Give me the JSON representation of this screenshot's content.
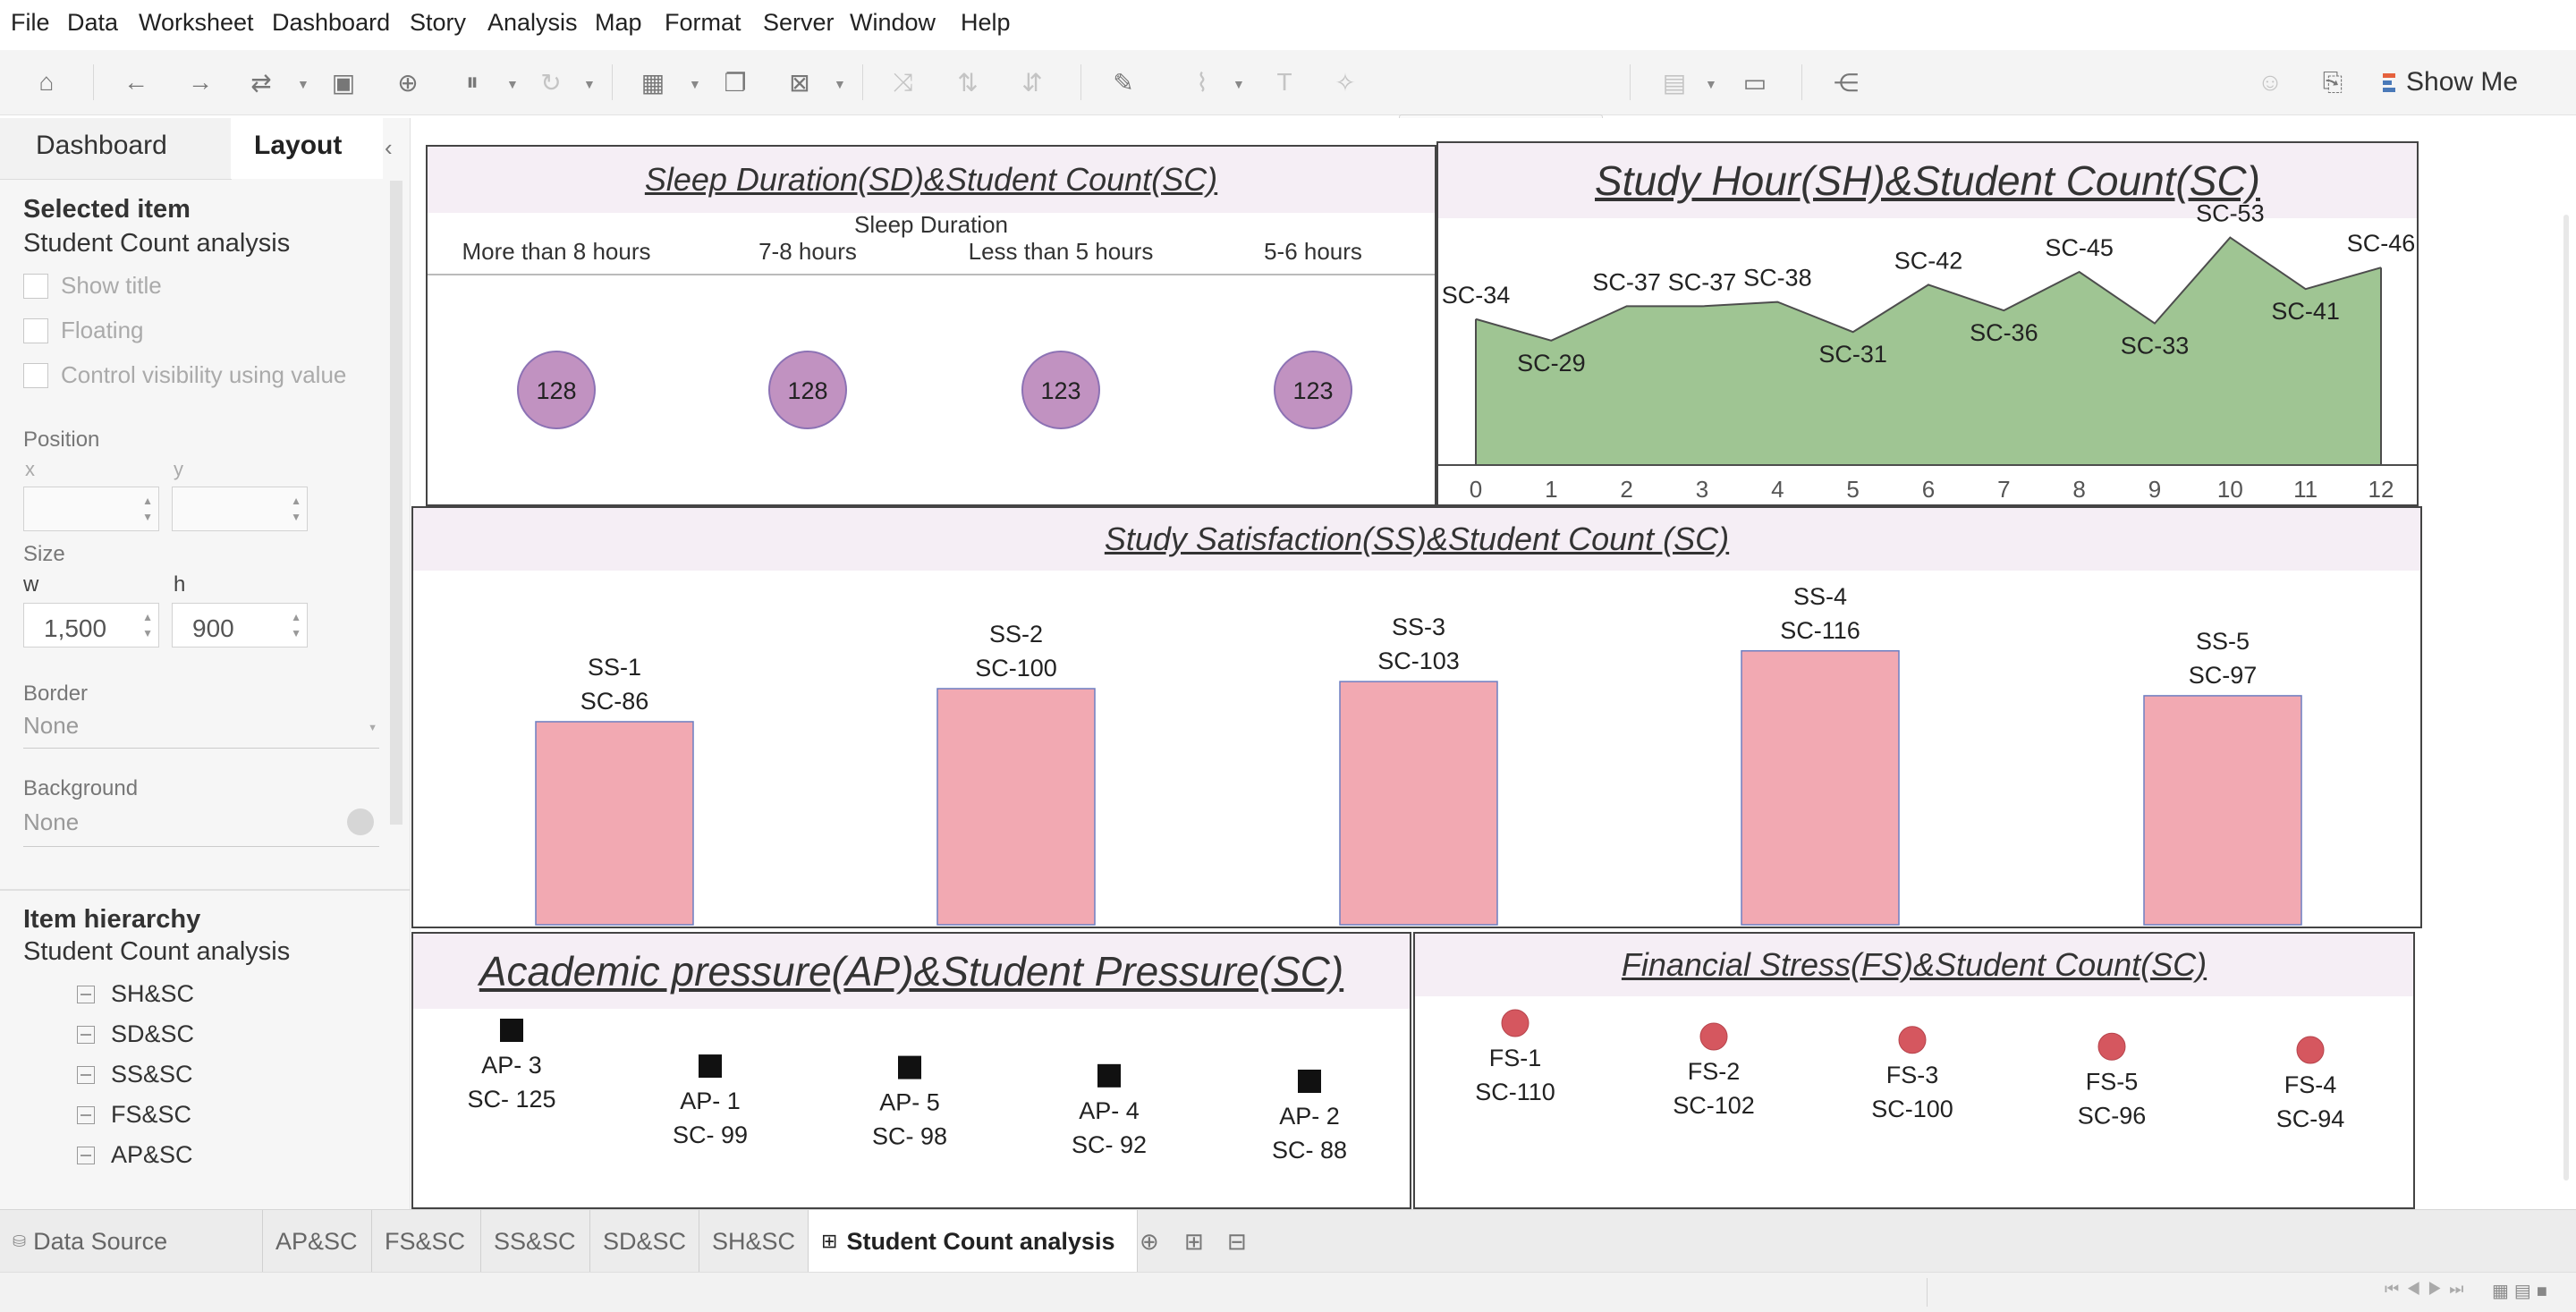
{
  "menu": [
    "File",
    "Data",
    "Worksheet",
    "Dashboard",
    "Story",
    "Analysis",
    "Map",
    "Format",
    "Server",
    "Window",
    "Help"
  ],
  "toolbar": {
    "show_me_label": "Show Me"
  },
  "left_pane": {
    "tabs": [
      "Dashboard",
      "Layout"
    ],
    "selected_item_heading": "Selected item",
    "selected_item_value": "Student Count analysis",
    "checkboxes": [
      "Show title",
      "Floating",
      "Control visibility using value"
    ],
    "position_label": "Position",
    "x_label": "x",
    "y_label": "y",
    "size_label": "Size",
    "w_label": "w",
    "h_label": "h",
    "w_value": "1,500",
    "h_value": "900",
    "border_label": "Border",
    "border_value": "None",
    "background_label": "Background",
    "background_value": "None",
    "hierarchy_heading": "Item hierarchy",
    "hierarchy_root": "Student Count analysis",
    "hierarchy_items": [
      "SH&SC",
      "SD&SC",
      "SS&SC",
      "FS&SC",
      "AP&SC"
    ]
  },
  "sheets": {
    "data_source": "Data Source",
    "tabs": [
      "AP&SC",
      "FS&SC",
      "SS&SC",
      "SD&SC",
      "SH&SC"
    ],
    "active": "Student Count analysis"
  },
  "colors": {
    "circle_fill": "#c192c1",
    "circle_stroke": "#8c72b4",
    "area_fill": "#9fc593",
    "bar_fill": "#f2a9b2",
    "bar_stroke": "#6d7fc2",
    "square_fill": "#111111",
    "dot_fill": "#d5575f"
  },
  "chart_data": [
    {
      "type": "scatter",
      "title": "Sleep Duration(SD)&Student Count(SC)",
      "column_header": "Sleep Duration",
      "categories": [
        "More than 8 hours",
        "7-8 hours",
        "Less than 5 hours",
        "5-6 hours"
      ],
      "values": [
        128,
        128,
        123,
        123
      ]
    },
    {
      "type": "area",
      "title": "Study Hour(SH)&Student Count(SC)",
      "x": [
        0,
        1,
        2,
        3,
        4,
        5,
        6,
        7,
        8,
        9,
        10,
        11,
        12
      ],
      "x_ticks": [
        "0",
        "1",
        "2",
        "3",
        "4",
        "5",
        "6",
        "7",
        "8",
        "9",
        "10",
        "11",
        "12"
      ],
      "labels": [
        "SC-34",
        "SC-29",
        "SC-37",
        "SC-37",
        "SC-38",
        "SC-31",
        "SC-42",
        "SC-36",
        "SC-45",
        "SC-33",
        "SC-53",
        "SC-41",
        "SC-46"
      ],
      "values": [
        34,
        29,
        37,
        37,
        38,
        31,
        42,
        36,
        45,
        33,
        53,
        41,
        46
      ],
      "ylim": [
        0,
        55
      ]
    },
    {
      "type": "bar",
      "title": "Study Satisfaction(SS)&Student Count (SC)",
      "categories": [
        "SS-1",
        "SS-2",
        "SS-3",
        "SS-4",
        "SS-5"
      ],
      "labels": [
        "SC-86",
        "SC-100",
        "SC-103",
        "SC-116",
        "SC-97"
      ],
      "values": [
        86,
        100,
        103,
        116,
        97
      ],
      "ylim": [
        0,
        150
      ]
    },
    {
      "type": "scatter",
      "title": "Academic pressure(AP)&Student Pressure(SC)",
      "categories": [
        "AP- 3",
        "AP- 1",
        "AP- 5",
        "AP- 4",
        "AP- 2"
      ],
      "labels": [
        "SC- 125",
        "SC- 99",
        "SC- 98",
        "SC- 92",
        "SC- 88"
      ],
      "values": [
        125,
        99,
        98,
        92,
        88
      ]
    },
    {
      "type": "scatter",
      "title": "Financial Stress(FS)&Student Count(SC)",
      "categories": [
        "FS-1",
        "FS-2",
        "FS-3",
        "FS-5",
        "FS-4"
      ],
      "labels": [
        "SC-110",
        "SC-102",
        "SC-100",
        "SC-96",
        "SC-94"
      ],
      "values": [
        110,
        102,
        100,
        96,
        94
      ]
    }
  ]
}
